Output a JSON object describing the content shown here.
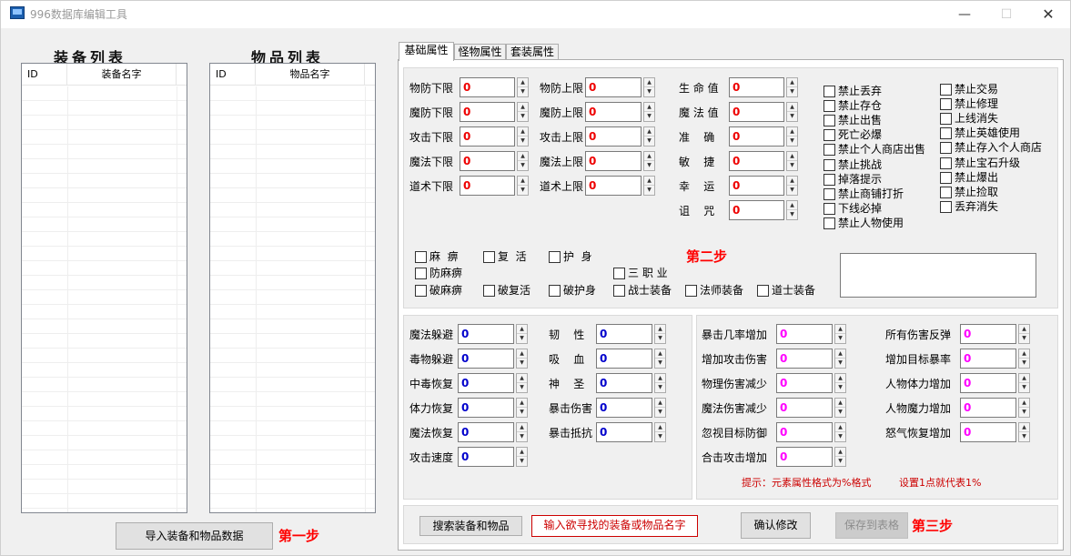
{
  "window": {
    "title": "996数据库编辑工具",
    "min_glyph": "—",
    "max_glyph": "☐",
    "close_glyph": "✕"
  },
  "equip_list": {
    "title": "装备列表",
    "columns": [
      "ID",
      "装备名字"
    ]
  },
  "item_list": {
    "title": "物品列表",
    "columns": [
      "ID",
      "物品名字"
    ]
  },
  "import_button": "导入装备和物品数据",
  "steps": {
    "one": "第一步",
    "two": "第二步",
    "three": "第三步"
  },
  "tabs": [
    "基础属性",
    "怪物属性",
    "套装属性"
  ],
  "basic": {
    "col1": [
      {
        "label": "物防下限",
        "value": "0"
      },
      {
        "label": "魔防下限",
        "value": "0"
      },
      {
        "label": "攻击下限",
        "value": "0"
      },
      {
        "label": "魔法下限",
        "value": "0"
      },
      {
        "label": "道术下限",
        "value": "0"
      }
    ],
    "col2": [
      {
        "label": "物防上限",
        "value": "0"
      },
      {
        "label": "魔防上限",
        "value": "0"
      },
      {
        "label": "攻击上限",
        "value": "0"
      },
      {
        "label": "魔法上限",
        "value": "0"
      },
      {
        "label": "道术上限",
        "value": "0"
      }
    ],
    "col3": [
      {
        "label": "生 命 值",
        "value": "0"
      },
      {
        "label": "魔 法 值",
        "value": "0"
      },
      {
        "label": "准    确",
        "value": "0"
      },
      {
        "label": "敏    捷",
        "value": "0"
      },
      {
        "label": "幸    运",
        "value": "0"
      },
      {
        "label": "诅    咒",
        "value": "0"
      }
    ]
  },
  "restrictions_left": [
    "禁止丢弃",
    "禁止存仓",
    "禁止出售",
    "死亡必爆",
    "禁止个人商店出售",
    "禁止挑战",
    "掉落提示",
    "禁止商铺打折",
    "下线必掉",
    "禁止人物使用"
  ],
  "restrictions_right": [
    "禁止交易",
    "禁止修理",
    "上线消失",
    "禁止英雄使用",
    "禁止存入个人商店",
    "禁止宝石升级",
    "禁止爆出",
    "禁止捡取",
    "丢弃消失"
  ],
  "special_checks": {
    "mabi": "麻  痹",
    "fuhuo": "复  活",
    "hushen": "护  身",
    "fangmabi": "防麻痹",
    "sanzhiye": "三 职 业",
    "pomabi": "破麻痹",
    "pofuhuo": "破复活",
    "pohushen": "破护身",
    "warrior": "战士装备",
    "mage": "法师装备",
    "taoist": "道士装备"
  },
  "attr_a": [
    {
      "label": "魔法躲避",
      "value": "0"
    },
    {
      "label": "毒物躲避",
      "value": "0"
    },
    {
      "label": "中毒恢复",
      "value": "0"
    },
    {
      "label": "体力恢复",
      "value": "0"
    },
    {
      "label": "魔法恢复",
      "value": "0"
    },
    {
      "label": "攻击速度",
      "value": "0"
    }
  ],
  "attr_b": [
    {
      "label": "韧    性",
      "value": "0"
    },
    {
      "label": "吸    血",
      "value": "0"
    },
    {
      "label": "神    圣",
      "value": "0"
    },
    {
      "label": "暴击伤害",
      "value": "0"
    },
    {
      "label": "暴击抵抗",
      "value": "0"
    }
  ],
  "attr_c": [
    {
      "label": "暴击几率增加",
      "value": "0"
    },
    {
      "label": "增加攻击伤害",
      "value": "0"
    },
    {
      "label": "物理伤害减少",
      "value": "0"
    },
    {
      "label": "魔法伤害减少",
      "value": "0"
    },
    {
      "label": "忽视目标防御",
      "value": "0"
    },
    {
      "label": "合击攻击增加",
      "value": "0"
    }
  ],
  "attr_d": [
    {
      "label": "所有伤害反弹",
      "value": "0"
    },
    {
      "label": "增加目标暴率",
      "value": "0"
    },
    {
      "label": "人物体力增加",
      "value": "0"
    },
    {
      "label": "人物魔力增加",
      "value": "0"
    },
    {
      "label": "怒气恢复增加",
      "value": "0"
    }
  ],
  "hint1": "提示：元素属性格式为%格式",
  "hint2": "设置1点就代表1%",
  "bottom": {
    "search_button": "搜索装备和物品",
    "search_placeholder": "输入欲寻找的装备或物品名字",
    "confirm_button": "确认修改",
    "save_button": "保存到表格"
  }
}
